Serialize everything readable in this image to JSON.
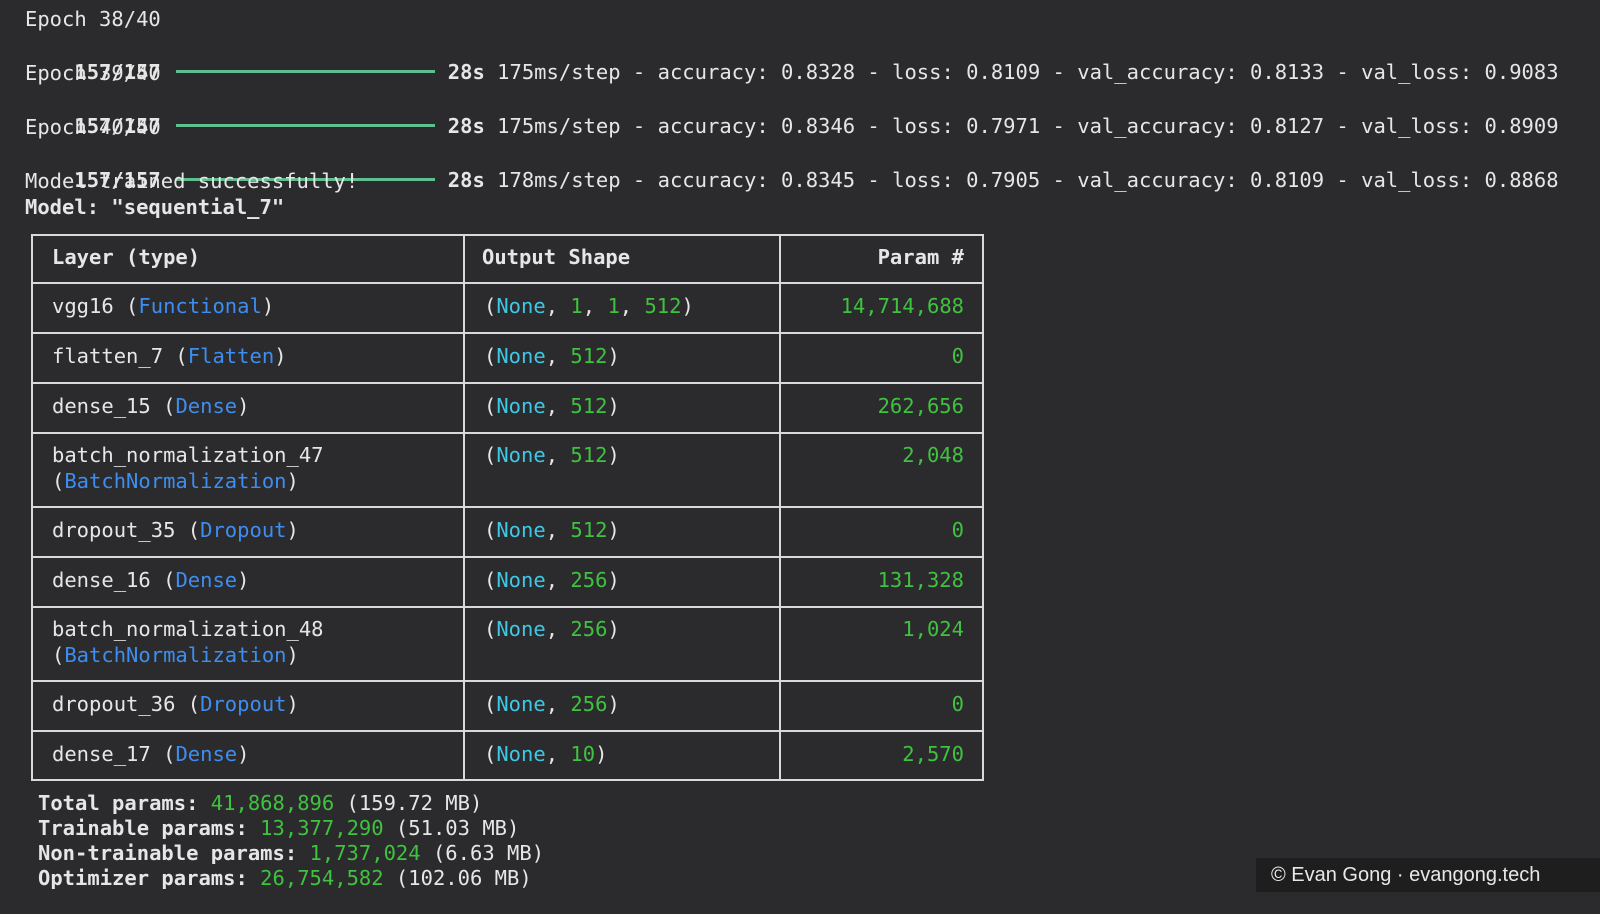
{
  "log": [
    {
      "epoch": "Epoch 38/40",
      "steps": "157/157",
      "time": "28s",
      "rest": "175ms/step - accuracy: 0.8328 - loss: 0.8109 - val_accuracy: 0.8133 - val_loss: 0.9083"
    },
    {
      "epoch": "Epoch 39/40",
      "steps": "157/157",
      "time": "28s",
      "rest": "175ms/step - accuracy: 0.8346 - loss: 0.7971 - val_accuracy: 0.8127 - val_loss: 0.8909"
    },
    {
      "epoch": "Epoch 40/40",
      "steps": "157/157",
      "time": "28s",
      "rest": "178ms/step - accuracy: 0.8345 - loss: 0.7905 - val_accuracy: 0.8109 - val_loss: 0.8868"
    }
  ],
  "progress_fraction": 1.0,
  "trained_message": "Model trained successfully!",
  "model_title": "Model: \"sequential_7\"",
  "table": {
    "headers": [
      "Layer (type)",
      "Output Shape",
      "Param #"
    ],
    "rows": [
      {
        "name": "vgg16",
        "type": "Functional",
        "shape": [
          "None",
          "1",
          "1",
          "512"
        ],
        "params": "14,714,688"
      },
      {
        "name": "flatten_7",
        "type": "Flatten",
        "shape": [
          "None",
          "512"
        ],
        "params": "0"
      },
      {
        "name": "dense_15",
        "type": "Dense",
        "shape": [
          "None",
          "512"
        ],
        "params": "262,656"
      },
      {
        "name": "batch_normalization_47",
        "type": "BatchNormalization",
        "shape": [
          "None",
          "512"
        ],
        "params": "2,048"
      },
      {
        "name": "dropout_35",
        "type": "Dropout",
        "shape": [
          "None",
          "512"
        ],
        "params": "0"
      },
      {
        "name": "dense_16",
        "type": "Dense",
        "shape": [
          "None",
          "256"
        ],
        "params": "131,328"
      },
      {
        "name": "batch_normalization_48",
        "type": "BatchNormalization",
        "shape": [
          "None",
          "256"
        ],
        "params": "1,024"
      },
      {
        "name": "dropout_36",
        "type": "Dropout",
        "shape": [
          "None",
          "256"
        ],
        "params": "0"
      },
      {
        "name": "dense_17",
        "type": "Dense",
        "shape": [
          "None",
          "10"
        ],
        "params": "2,570"
      }
    ]
  },
  "summary": [
    {
      "label": "Total params: ",
      "value": "41,868,896",
      "size": " (159.72 MB)"
    },
    {
      "label": "Trainable params: ",
      "value": "13,377,290",
      "size": " (51.03 MB)"
    },
    {
      "label": "Non-trainable params: ",
      "value": "1,737,024",
      "size": " (6.63 MB)"
    },
    {
      "label": "Optimizer params: ",
      "value": "26,754,582",
      "size": " (102.06 MB)"
    }
  ],
  "watermark": "© Evan Gong · evangong.tech",
  "colors": {
    "background": "#2b2b2d",
    "progress_bar": "#5fbf8f",
    "number_green": "#3fc23f",
    "shape_cyan": "#3ec8e6",
    "type_blue": "#3d8ef0",
    "border": "#d9d9d9"
  }
}
